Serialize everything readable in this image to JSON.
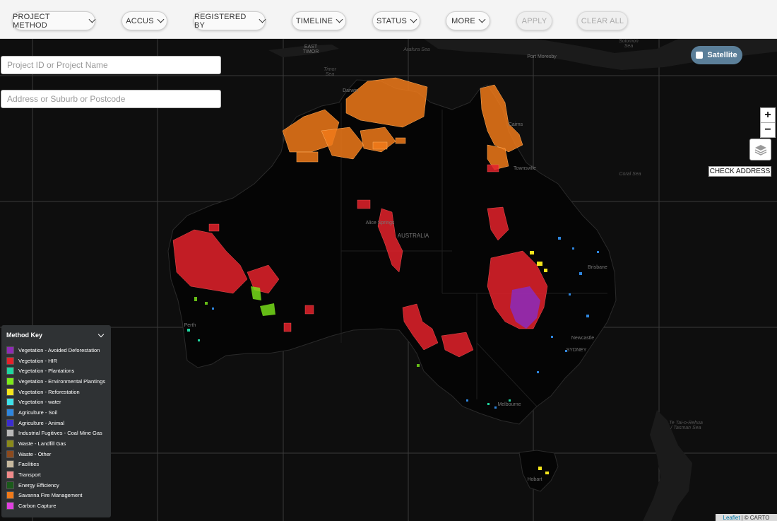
{
  "filters": [
    {
      "label": "PROJECT METHOD",
      "disabled": false
    },
    {
      "label": "ACCUS",
      "disabled": false
    },
    {
      "label": "REGISTERED BY",
      "disabled": false
    },
    {
      "label": "TIMELINE",
      "disabled": false
    },
    {
      "label": "STATUS",
      "disabled": false
    },
    {
      "label": "MORE",
      "disabled": false
    },
    {
      "label": "APPLY",
      "disabled": true
    },
    {
      "label": "CLEAR ALL",
      "disabled": true
    }
  ],
  "search": {
    "project_placeholder": "Project ID or Project Name",
    "address_placeholder": "Address or Suburb or Postcode"
  },
  "map_controls": {
    "satellite_label": "Satellite",
    "zoom_in": "+",
    "zoom_out": "−",
    "layers_icon": "layers-icon",
    "check_address_label": "CHECK ADDRESS"
  },
  "map_labels": [
    {
      "text": "EAST TIMOR",
      "kind": "land"
    },
    {
      "text": "Arafura Sea",
      "kind": "sea"
    },
    {
      "text": "Port Moresby",
      "kind": "land"
    },
    {
      "text": "Solomon Sea",
      "kind": "sea"
    },
    {
      "text": "Timor Sea",
      "kind": "sea"
    },
    {
      "text": "Coral Sea",
      "kind": "sea"
    },
    {
      "text": "Townsville",
      "kind": "land"
    },
    {
      "text": "Alice Springs",
      "kind": "land"
    },
    {
      "text": "AUSTRALIA",
      "kind": "land"
    },
    {
      "text": "Brisbane",
      "kind": "land"
    },
    {
      "text": "Perth",
      "kind": "land"
    },
    {
      "text": "Newcastle",
      "kind": "land"
    },
    {
      "text": "SYDNEY",
      "kind": "land"
    },
    {
      "text": "Melbourne",
      "kind": "land"
    },
    {
      "text": "Hobart",
      "kind": "land"
    },
    {
      "text": "Te Tai-o-Rehua / Tasman Sea",
      "kind": "sea"
    },
    {
      "text": "Darwin",
      "kind": "land"
    },
    {
      "text": "Cairns",
      "kind": "land"
    }
  ],
  "legend": {
    "title": "Method Key",
    "items": [
      {
        "label": "Vegetation - Avoided Deforestation",
        "color": "#8e2bb5"
      },
      {
        "label": "Vegetation - HIR",
        "color": "#e4222b"
      },
      {
        "label": "Vegetation - Plantations",
        "color": "#1fd6a0"
      },
      {
        "label": "Vegetation - Environmental Plantings",
        "color": "#7dea1a"
      },
      {
        "label": "Vegetation - Reforestation",
        "color": "#f5e51c"
      },
      {
        "label": "Vegetation - water",
        "color": "#3fe0e8"
      },
      {
        "label": "Agriculture - Soil",
        "color": "#2e86de"
      },
      {
        "label": "Agriculture - Animal",
        "color": "#3b2dd1"
      },
      {
        "label": "Industrial Fugitives - Coal Mine Gas",
        "color": "#b8b8b8"
      },
      {
        "label": "Waste - Landfill Gas",
        "color": "#8a8a1a"
      },
      {
        "label": "Waste - Other",
        "color": "#8b4a1e"
      },
      {
        "label": "Facilities",
        "color": "#c6b89e"
      },
      {
        "label": "Transport",
        "color": "#f08a8a"
      },
      {
        "label": "Energy Efficiency",
        "color": "#1a5a1a"
      },
      {
        "label": "Savanna Fire Management",
        "color": "#f07a1a"
      },
      {
        "label": "Carbon Capture",
        "color": "#e040e0"
      }
    ]
  },
  "attribution": {
    "leaflet": "Leaflet",
    "sep": "|",
    "carto": "© CARTO"
  }
}
